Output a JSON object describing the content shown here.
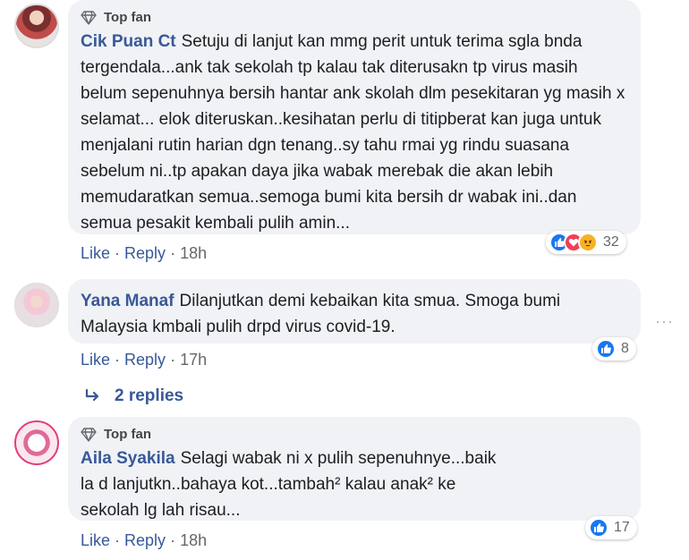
{
  "comments": [
    {
      "badge": "Top fan",
      "author": "Cik Puan Ct",
      "text": "Setuju di lanjut kan mmg perit untuk terima sgla bnda tergendala...ank tak sekolah tp kalau tak diterusakn tp virus masih belum sepenuhnya bersih hantar ank skolah dlm pesekitaran yg masih x selamat... elok diteruskan..kesihatan perlu di titipberat kan juga untuk menjalani rutin harian dgn tenang..sy tahu rmai yg rindu suasana sebelum ni..tp apakan daya jika wabak merebak die akan lebih memudaratkan semua..semoga bumi kita bersih dr wabak ini..dan semua pesakit kembali pulih amin...",
      "like": "Like",
      "reply": "Reply",
      "sep": "·",
      "time": "18h",
      "reaction_count": "32",
      "reactions": [
        "like-icon",
        "love-icon",
        "angry-icon"
      ]
    },
    {
      "author": "Yana Manaf",
      "text": "Dilanjutkan demi kebaikan kita smua. Smoga bumi Malaysia kmbali pulih drpd virus covid-19.",
      "like": "Like",
      "reply": "Reply",
      "sep": "·",
      "time": "17h",
      "reaction_count": "8",
      "reactions": [
        "like-icon"
      ],
      "more_options": "···",
      "replies_label": "2 replies"
    },
    {
      "badge": "Top fan",
      "author": "Aila Syakila",
      "text": "Selagi wabak ni x pulih sepenuhnye...baik la d lanjutkn..bahaya kot...tambah² kalau anak² ke sekolah lg lah risau...",
      "like": "Like",
      "reply": "Reply",
      "sep": "·",
      "time": "18h",
      "reaction_count": "17",
      "reactions": [
        "like-icon"
      ]
    }
  ],
  "colors": {
    "link": "#385898",
    "bubble": "#f0f2f5",
    "like": "#1877f2",
    "love": "#f33e58",
    "angry": "#f7b125"
  }
}
